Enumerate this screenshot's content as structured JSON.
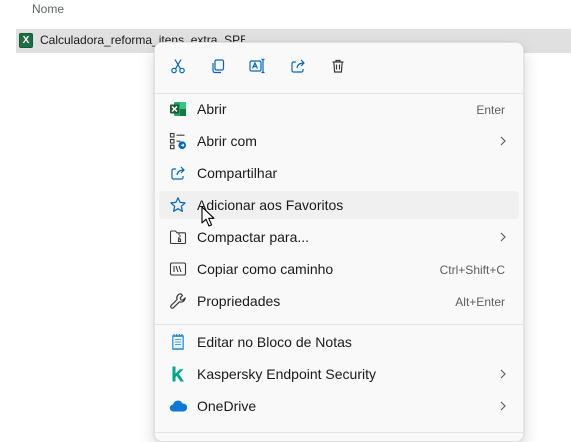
{
  "explorer": {
    "column_name": "Nome",
    "selected_file": {
      "name": "Calculadora_reforma_itens_extra_SPED",
      "icon": "excel-file-icon",
      "icon_letter": "X"
    }
  },
  "context_menu": {
    "toolbar": [
      {
        "name": "cut-button",
        "icon": "scissors-icon"
      },
      {
        "name": "copy-button",
        "icon": "copy-icon"
      },
      {
        "name": "rename-button",
        "icon": "rename-icon"
      },
      {
        "name": "share-button",
        "icon": "share-icon"
      },
      {
        "name": "delete-button",
        "icon": "trash-icon"
      }
    ],
    "items": [
      {
        "label": "Abrir",
        "shortcut": "Enter",
        "icon": "excel-icon"
      },
      {
        "label": "Abrir com",
        "icon": "open-with-icon",
        "submenu": true
      },
      {
        "label": "Compartilhar",
        "icon": "share-icon"
      },
      {
        "label": "Adicionar aos Favoritos",
        "icon": "star-icon",
        "hovered": true
      },
      {
        "label": "Compactar para...",
        "icon": "zip-folder-icon",
        "submenu": true
      },
      {
        "label": "Copiar como caminho",
        "shortcut": "Ctrl+Shift+C",
        "icon": "copy-path-icon"
      },
      {
        "label": "Propriedades",
        "shortcut": "Alt+Enter",
        "icon": "wrench-icon"
      },
      {
        "label": "Editar no Bloco de Notas",
        "icon": "notepad-icon"
      },
      {
        "label": "Kaspersky Endpoint Security",
        "icon": "kaspersky-icon",
        "submenu": true
      },
      {
        "label": "OneDrive",
        "icon": "onedrive-icon",
        "submenu": true
      }
    ]
  },
  "colors": {
    "accent_blue": "#0067c0",
    "excel_green": "#1d6f42",
    "kaspersky_green": "#00a88e",
    "onedrive_blue": "#0f78d4",
    "selection_bg": "#e0e0e0",
    "menu_bg": "#f9f9f9"
  }
}
